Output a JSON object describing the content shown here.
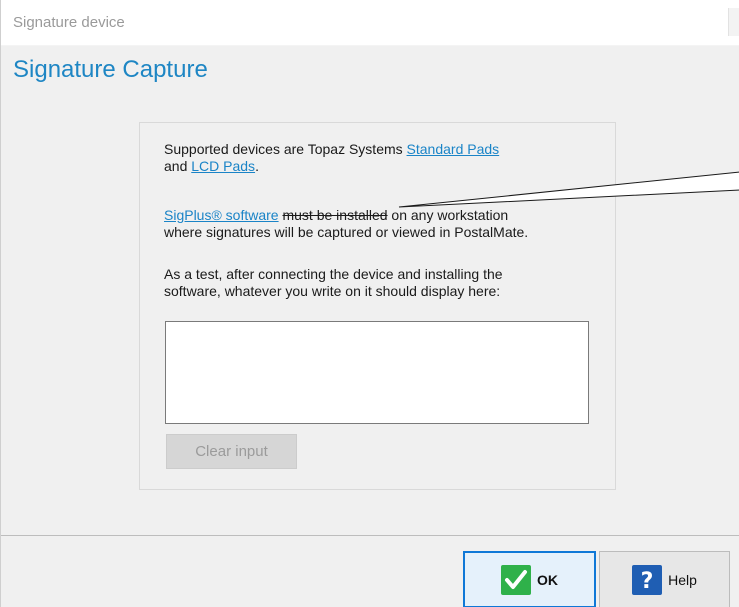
{
  "window": {
    "title": "Signature device"
  },
  "heading": "Signature Capture",
  "intro": {
    "text_before": "Supported devices are Topaz Systems ",
    "link_standard": "Standard Pads",
    "text_and": "and ",
    "link_lcd": "LCD Pads",
    "text_period": "."
  },
  "software": {
    "link": "SigPlus® software",
    "text_space": " ",
    "struck": "must be installed",
    "text_rest": " on any workstation",
    "line2": "where signatures will be captured or viewed in PostalMate."
  },
  "test": {
    "line1": "As a test, after connecting the device and installing the",
    "line2": "software, whatever you write on it should display here:"
  },
  "signature_box": {
    "value": ""
  },
  "buttons": {
    "clear_input": "Clear input",
    "ok": "OK",
    "help": "Help"
  },
  "icons": {
    "ok": "checkmark-icon",
    "help": "question-mark-icon"
  },
  "colors": {
    "heading": "#1e86c4",
    "link": "#1a84c7",
    "ok_icon_bg": "#2fb14a",
    "help_icon_bg": "#1f5eb3",
    "ok_border": "#0f78d7"
  }
}
